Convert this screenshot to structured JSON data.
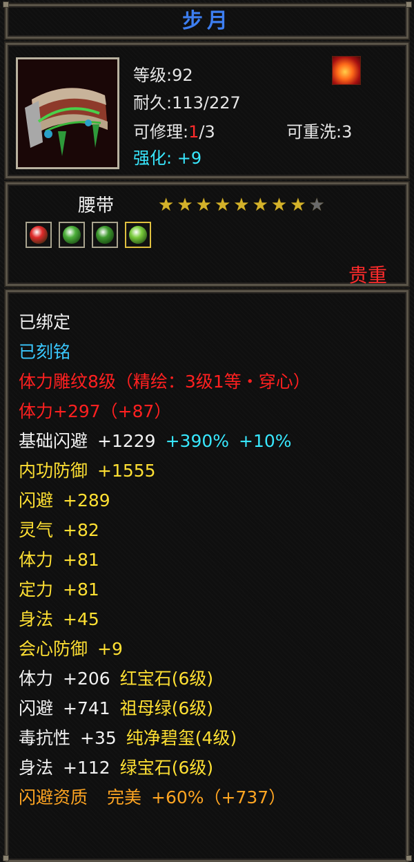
{
  "title": "步月",
  "stats": {
    "level_label": "等级",
    "level_value": "92",
    "durability_label": "耐久",
    "durability_value": "113/227",
    "repair_label": "可修理",
    "repair_used": "1",
    "repair_total": "/3",
    "rewash_label": "可重洗",
    "rewash_value": "3",
    "enhance_label": "强化",
    "enhance_value": "+9"
  },
  "item": {
    "name": "腰带",
    "stars_filled": 8,
    "stars_total": 9,
    "gems": [
      {
        "icon": "red-orb-icon",
        "color": "#e02a2a"
      },
      {
        "icon": "green-leaf-icon",
        "color": "#4caf3a"
      },
      {
        "icon": "green-leaf-icon",
        "color": "#3e9a2e"
      },
      {
        "icon": "green-orb-icon",
        "color": "#7acb3c"
      }
    ],
    "rarity": "贵重"
  },
  "attributes": {
    "bound": "已绑定",
    "engraved": "已刻铭",
    "carving": "体力雕纹8级（精绘：3级1等・穿心）",
    "vitality_bonus": "体力+297（+87）",
    "dodge_base_label": "基础闪避",
    "dodge_base_value": "+1229",
    "dodge_base_pct1": "+390%",
    "dodge_base_pct2": "+10%",
    "rows": [
      {
        "label": "内功防御",
        "value": "+1555"
      },
      {
        "label": "闪避",
        "value": "+289"
      },
      {
        "label": "灵气",
        "value": "+82"
      },
      {
        "label": "体力",
        "value": "+81"
      },
      {
        "label": "定力",
        "value": "+81"
      },
      {
        "label": "身法",
        "value": "+45"
      },
      {
        "label": "会心防御",
        "value": "+9"
      },
      {
        "label": "体力",
        "value": "+206",
        "gem": "红宝石(6级)"
      },
      {
        "label": "闪避",
        "value": "+741",
        "gem": "祖母绿(6级)"
      },
      {
        "label": "毒抗性",
        "value": "+35",
        "gem": "纯净碧玺(4级)"
      },
      {
        "label": "身法",
        "value": "+112",
        "gem": "绿宝石(6级)"
      }
    ],
    "quality_label": "闪避资质",
    "quality_grade": "完美",
    "quality_value": "+60%（+737）"
  }
}
